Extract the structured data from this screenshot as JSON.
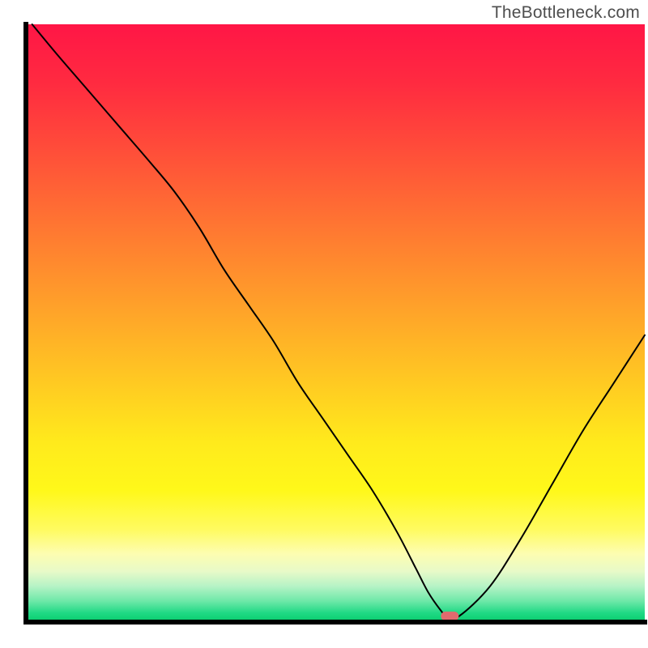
{
  "watermark": "TheBottleneck.com",
  "chart_data": {
    "type": "line",
    "title": "",
    "xlabel": "",
    "ylabel": "",
    "xlim": [
      0,
      100
    ],
    "ylim": [
      0,
      100
    ],
    "series": [
      {
        "name": "bottleneck-curve",
        "x": [
          1,
          5,
          10,
          15,
          20,
          24,
          28,
          32,
          36,
          40,
          44,
          48,
          52,
          56,
          60,
          63,
          65,
          67,
          68,
          70,
          75,
          80,
          85,
          90,
          95,
          100
        ],
        "y": [
          100,
          95,
          89,
          83,
          77,
          72,
          66,
          59,
          53,
          47,
          40,
          34,
          28,
          22,
          15,
          9,
          5,
          2,
          1,
          1,
          6,
          14,
          23,
          32,
          40,
          48
        ]
      }
    ],
    "marker": {
      "x": 68.5,
      "y": 1
    },
    "gradient_stops": [
      {
        "offset": 0.0,
        "color": "#ff1646"
      },
      {
        "offset": 0.1,
        "color": "#ff2b40"
      },
      {
        "offset": 0.2,
        "color": "#ff4a3a"
      },
      {
        "offset": 0.3,
        "color": "#ff6a34"
      },
      {
        "offset": 0.4,
        "color": "#ff8a2e"
      },
      {
        "offset": 0.5,
        "color": "#ffaa28"
      },
      {
        "offset": 0.6,
        "color": "#ffca22"
      },
      {
        "offset": 0.7,
        "color": "#ffea1c"
      },
      {
        "offset": 0.78,
        "color": "#fff81a"
      },
      {
        "offset": 0.845,
        "color": "#fffb60"
      },
      {
        "offset": 0.885,
        "color": "#fdfdb0"
      },
      {
        "offset": 0.915,
        "color": "#e8fac8"
      },
      {
        "offset": 0.94,
        "color": "#b6f3c6"
      },
      {
        "offset": 0.965,
        "color": "#6de8a8"
      },
      {
        "offset": 0.985,
        "color": "#1fd984"
      },
      {
        "offset": 1.0,
        "color": "#07cc6d"
      }
    ],
    "marker_color": "#e26a6e",
    "axis_color": "#000000",
    "curve_color": "#000000",
    "curve_width": 2
  }
}
